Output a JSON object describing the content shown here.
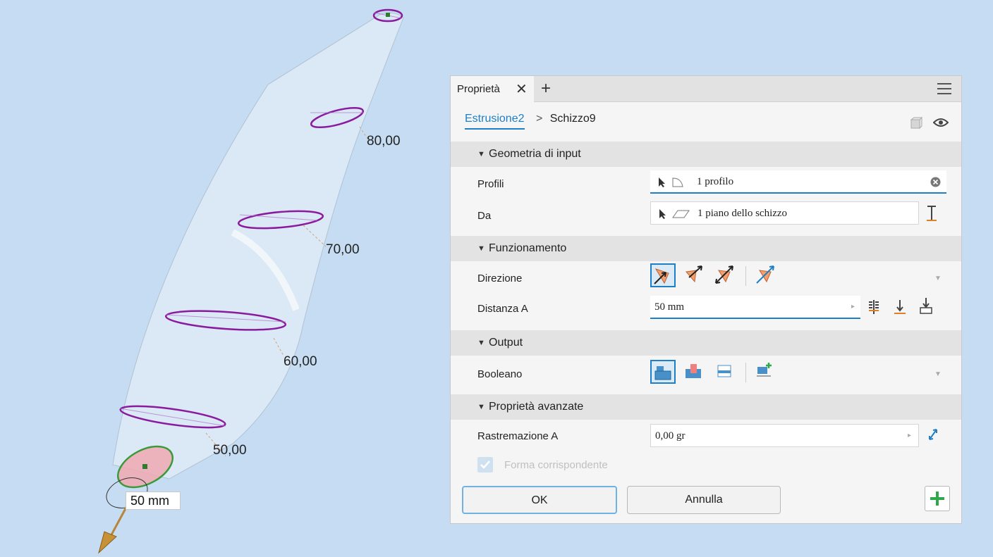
{
  "viewport": {
    "dimensions": [
      "80,00",
      "70,00",
      "60,00",
      "50,00"
    ],
    "extrude_input": "50 mm"
  },
  "panel": {
    "tab_label": "Proprietà",
    "tab_close": "✕",
    "tab_add": "+",
    "breadcrumb": {
      "feature": "Estrusione2",
      "sketch": "Schizzo9"
    },
    "sections": {
      "input_geometry": "Geometria di input",
      "behavior": "Funzionamento",
      "output": "Output",
      "advanced": "Proprietà avanzate"
    },
    "rows": {
      "profiles_label": "Profili",
      "profiles_value": "1 profilo",
      "from_label": "Da",
      "from_value": "1 piano dello schizzo",
      "direction_label": "Direzione",
      "distance_label": "Distanza A",
      "distance_value": "50 mm",
      "boolean_label": "Booleano",
      "taper_label": "Rastremazione A",
      "taper_value": "0,00 gr",
      "match_shape_label": "Forma corrispondente"
    },
    "buttons": {
      "ok": "OK",
      "cancel": "Annulla"
    }
  },
  "colors": {
    "viewport_bg": "#c5dcf2",
    "accent": "#1e7fc6",
    "sketch": "#8a1a9e",
    "add_green": "#2ea84a",
    "extrude_face": "#f0a9b2"
  }
}
